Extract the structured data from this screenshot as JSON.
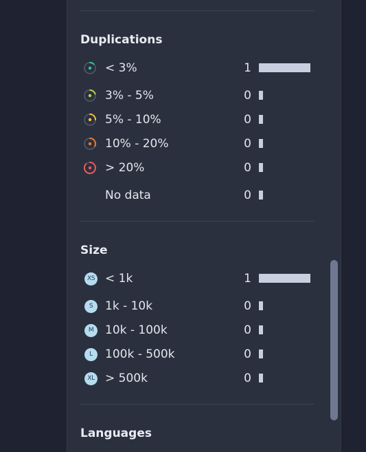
{
  "sections": {
    "duplications": {
      "title": "Duplications",
      "items": [
        {
          "label": "< 3%",
          "count": "1",
          "fraction": 1.0,
          "color": "#2ecc8a",
          "icon": "duplication-level-a-icon"
        },
        {
          "label": "3% - 5%",
          "count": "0",
          "fraction": 0,
          "color": "#b7d14d",
          "icon": "duplication-level-b-icon"
        },
        {
          "label": "5% - 10%",
          "count": "0",
          "fraction": 0,
          "color": "#f1c23b",
          "icon": "duplication-level-c-icon"
        },
        {
          "label": "10% - 20%",
          "count": "0",
          "fraction": 0,
          "color": "#f0772c",
          "icon": "duplication-level-d-icon"
        },
        {
          "label": "> 20%",
          "count": "0",
          "fraction": 0,
          "color": "#e85a5a",
          "icon": "duplication-level-e-icon"
        },
        {
          "label": "No data",
          "count": "0",
          "fraction": 0
        }
      ]
    },
    "size": {
      "title": "Size",
      "items": [
        {
          "badge": "XS",
          "label": "< 1k",
          "count": "1",
          "fraction": 1.0
        },
        {
          "badge": "S",
          "label": "1k - 10k",
          "count": "0",
          "fraction": 0
        },
        {
          "badge": "M",
          "label": "10k - 100k",
          "count": "0",
          "fraction": 0
        },
        {
          "badge": "L",
          "label": "100k - 500k",
          "count": "0",
          "fraction": 0
        },
        {
          "badge": "XL",
          "label": "> 500k",
          "count": "0",
          "fraction": 0
        }
      ]
    },
    "languages": {
      "title": "Languages"
    }
  },
  "colors": {
    "bar": "#c9cfdf",
    "ring_track": "#4a5163"
  }
}
